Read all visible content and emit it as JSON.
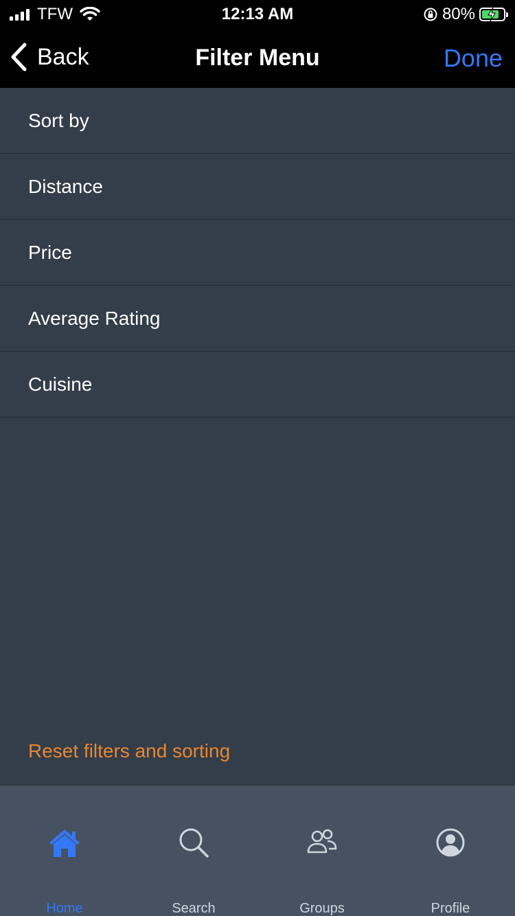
{
  "status_bar": {
    "carrier": "TFW",
    "time": "12:13 AM",
    "battery_percent": "80%",
    "battery_level": 0.8
  },
  "nav": {
    "back_label": "Back",
    "title": "Filter Menu",
    "done_label": "Done"
  },
  "menu": {
    "items": [
      {
        "label": "Sort by"
      },
      {
        "label": "Distance"
      },
      {
        "label": "Price"
      },
      {
        "label": "Average Rating"
      },
      {
        "label": "Cuisine"
      }
    ]
  },
  "reset_label": "Reset filters and sorting",
  "tabs": [
    {
      "label": "Home",
      "icon": "home-icon",
      "active": true
    },
    {
      "label": "Search",
      "icon": "search-icon",
      "active": false
    },
    {
      "label": "Groups",
      "icon": "groups-icon",
      "active": false
    },
    {
      "label": "Profile",
      "icon": "profile-icon",
      "active": false
    }
  ],
  "colors": {
    "accent": "#3478f6",
    "reset": "#e8872f",
    "background": "#343d4a",
    "tab_bar": "#465161"
  }
}
